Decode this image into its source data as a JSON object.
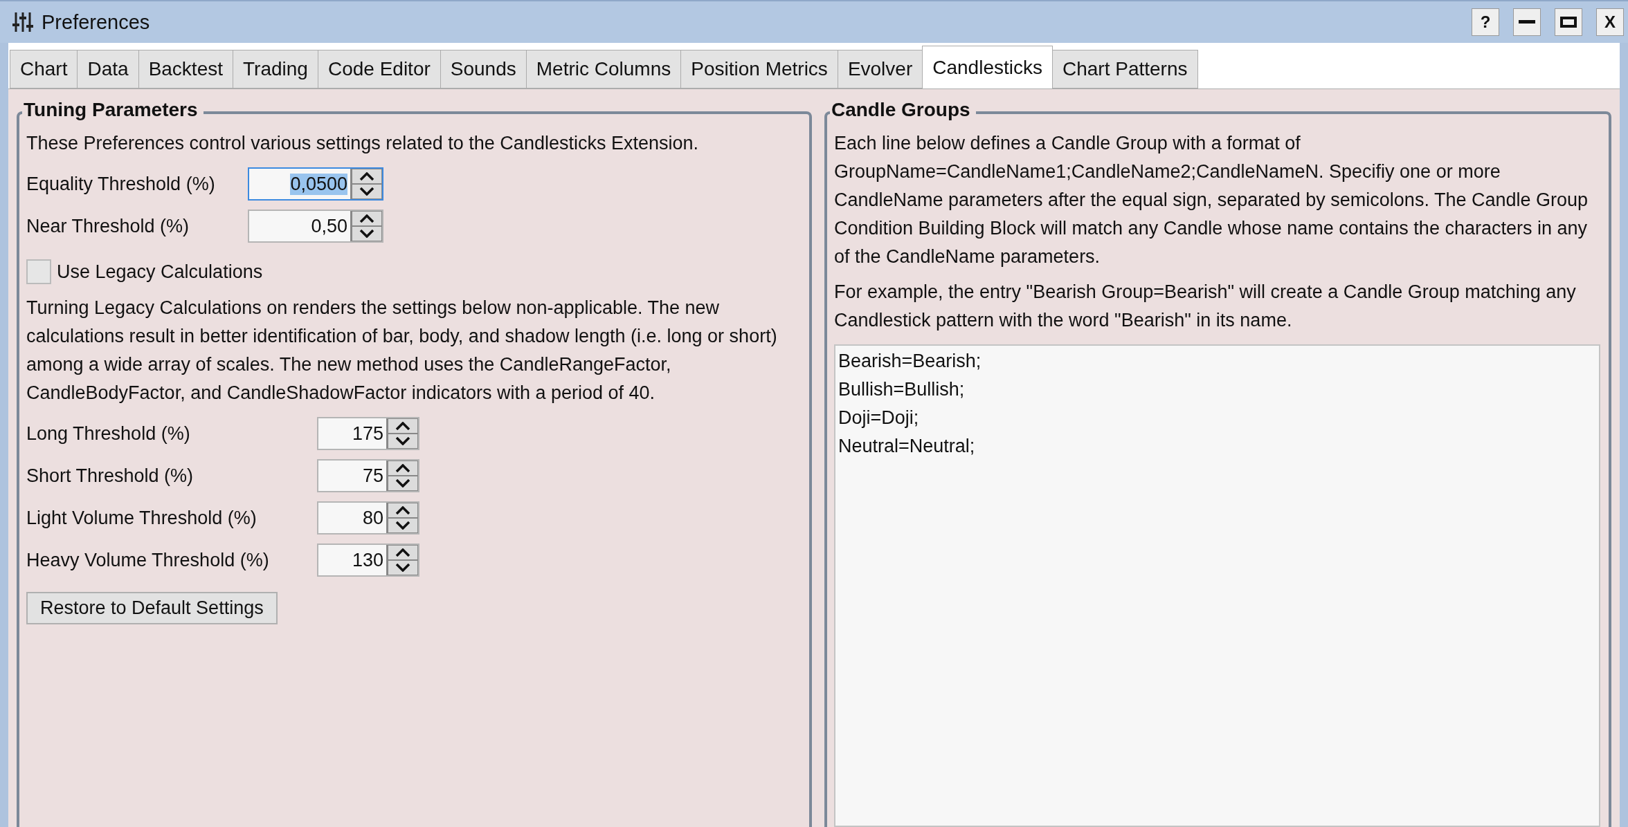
{
  "window": {
    "title": "Preferences"
  },
  "title_buttons": [
    {
      "kind": "text",
      "label": "?"
    },
    {
      "kind": "minimize"
    },
    {
      "kind": "maximize"
    },
    {
      "kind": "text",
      "label": "X"
    }
  ],
  "tabs": [
    {
      "label": "Chart",
      "selected": false
    },
    {
      "label": "Data",
      "selected": false
    },
    {
      "label": "Backtest",
      "selected": false
    },
    {
      "label": "Trading",
      "selected": false
    },
    {
      "label": "Code Editor",
      "selected": false
    },
    {
      "label": "Sounds",
      "selected": false
    },
    {
      "label": "Metric Columns",
      "selected": false
    },
    {
      "label": "Position Metrics",
      "selected": false
    },
    {
      "label": "Evolver",
      "selected": false
    },
    {
      "label": "Candlesticks",
      "selected": true
    },
    {
      "label": "Chart Patterns",
      "selected": false
    }
  ],
  "tuning": {
    "title": "Tuning Parameters",
    "intro": "These Preferences control various settings related to the Candlesticks Extension.",
    "thresholds": [
      {
        "label": "Equality Threshold (%)",
        "value": "0,0500",
        "focused": true
      },
      {
        "label": "Near Threshold (%)",
        "value": "0,50",
        "focused": false
      }
    ],
    "legacy": {
      "label": "Use Legacy Calculations",
      "checked": false
    },
    "note": "Turning Legacy Calculations on renders the settings below non-applicable. The new calculations result in better identification of bar, body, and shadow length (i.e. long or short) among a wide array of scales. The new method uses the CandleRangeFactor, CandleBodyFactor, and CandleShadowFactor indicators with a period of 40.",
    "factors": [
      {
        "label": "Long Threshold (%)",
        "value": "175",
        "focused": false
      },
      {
        "label": "Short Threshold (%)",
        "value": "75",
        "focused": false
      },
      {
        "label": "Light Volume Threshold (%)",
        "value": "80",
        "focused": false
      },
      {
        "label": "Heavy Volume Threshold (%)",
        "value": "130",
        "focused": false
      }
    ],
    "restore_button": "Restore to Default Settings"
  },
  "candle_groups": {
    "title": "Candle Groups",
    "description": "Each line below defines a Candle Group with a format of GroupName=CandleName1;CandleName2;CandleNameN. Specifiy one or more CandleName parameters after the equal sign, separated by semicolons. The Candle Group Condition Building Block will match any Candle whose name contains the characters in any of the CandleName parameters.",
    "example": "For example, the entry \"Bearish Group=Bearish\" will create a Candle Group matching any Candlestick pattern with the word \"Bearish\" in its name.",
    "lines": [
      "Bearish=Bearish;",
      "Bullish=Bullish;",
      "Doji=Doji;",
      "Neutral=Neutral;"
    ]
  }
}
